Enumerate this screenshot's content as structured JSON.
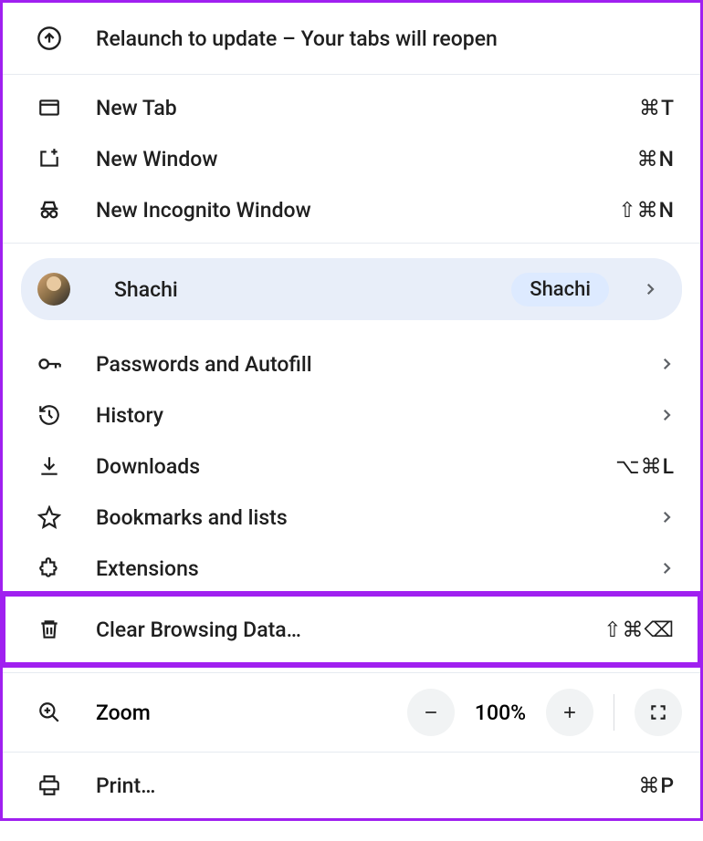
{
  "update": {
    "label": "Relaunch to update – Your tabs will reopen"
  },
  "newTab": {
    "label": "New Tab",
    "shortcut": "⌘T"
  },
  "newWindow": {
    "label": "New Window",
    "shortcut": "⌘N"
  },
  "newIncognito": {
    "label": "New Incognito Window",
    "shortcut": "⇧⌘N"
  },
  "profile": {
    "label": "Shachi",
    "badge": "Shachi"
  },
  "passwords": {
    "label": "Passwords and Autofill"
  },
  "history": {
    "label": "History"
  },
  "downloads": {
    "label": "Downloads",
    "shortcut": "⌥⌘L"
  },
  "bookmarks": {
    "label": "Bookmarks and lists"
  },
  "extensions": {
    "label": "Extensions"
  },
  "clearData": {
    "label": "Clear Browsing Data…",
    "shortcut": "⇧⌘⌫"
  },
  "zoom": {
    "label": "Zoom",
    "value": "100%"
  },
  "print": {
    "label": "Print…",
    "shortcut": "⌘P"
  }
}
